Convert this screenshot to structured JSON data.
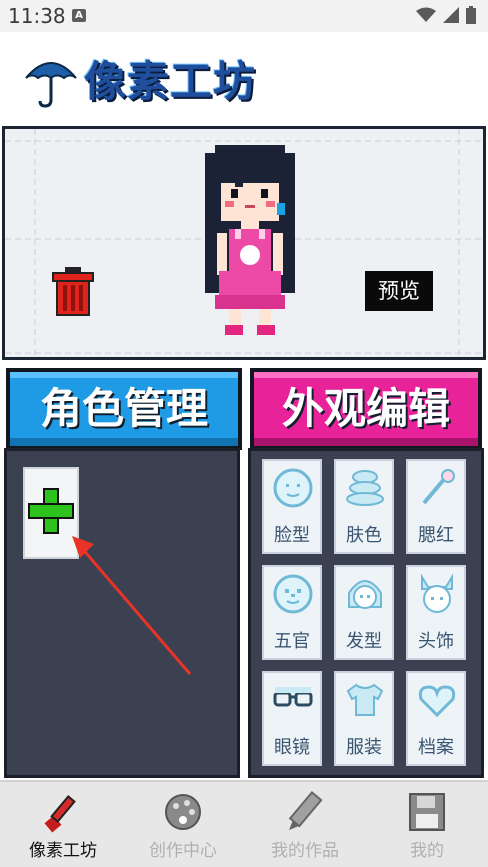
{
  "status_bar": {
    "time": "11:38",
    "notification_letter": "A"
  },
  "header": {
    "app_title": "像素工坊",
    "logo_icon": "umbrella-icon",
    "accent_color": "#1f4f9c"
  },
  "canvas": {
    "delete_icon": "trash-icon",
    "preview_label": "预览"
  },
  "tabs": {
    "roles": {
      "label": "角色管理",
      "color": "#1f9be6"
    },
    "appearance": {
      "label": "外观编辑",
      "color": "#e8239a"
    }
  },
  "roles_panel": {
    "add_icon": "plus-icon"
  },
  "appearance_items": [
    {
      "label": "脸型",
      "icon": "face-shape-icon"
    },
    {
      "label": "肤色",
      "icon": "skin-color-icon"
    },
    {
      "label": "腮红",
      "icon": "blush-brush-icon"
    },
    {
      "label": "五官",
      "icon": "facial-features-icon"
    },
    {
      "label": "发型",
      "icon": "hairstyle-icon"
    },
    {
      "label": "头饰",
      "icon": "headwear-icon"
    },
    {
      "label": "眼镜",
      "icon": "glasses-icon"
    },
    {
      "label": "服装",
      "icon": "clothing-icon"
    },
    {
      "label": "档案",
      "icon": "heart-profile-icon"
    }
  ],
  "bottom_nav": [
    {
      "label": "像素工坊",
      "icon": "paintbrush-icon",
      "active": true
    },
    {
      "label": "创作中心",
      "icon": "palette-icon",
      "active": false
    },
    {
      "label": "我的作品",
      "icon": "pencil-icon",
      "active": false
    },
    {
      "label": "我的",
      "icon": "floppy-disk-icon",
      "active": false
    }
  ]
}
